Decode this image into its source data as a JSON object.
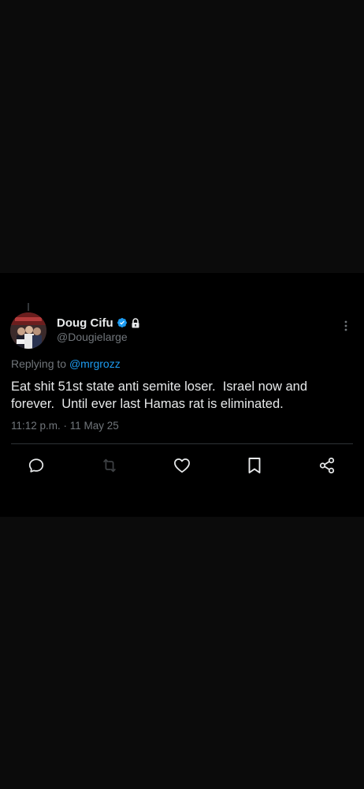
{
  "tweet": {
    "author": {
      "display_name": "Doug Cifu",
      "handle": "@Dougielarge",
      "verified": true,
      "protected": true
    },
    "reply_prefix": "Replying to",
    "reply_to": "@mrgrozz",
    "text": "Eat shit 51st state anti semite loser.  Israel now and forever.  Until ever last Hamas rat is eliminated.",
    "timestamp": "11:12 p.m. · 11 May 25"
  },
  "icons": {
    "verified": "verified-badge-icon",
    "lock": "lock-icon",
    "more": "more-vertical-icon",
    "reply": "reply-icon",
    "retweet": "retweet-icon",
    "like": "heart-icon",
    "bookmark": "bookmark-icon",
    "share": "share-icon"
  },
  "colors": {
    "background": "#000000",
    "page_background": "#0b0b0b",
    "primary_text": "#e7e9ea",
    "secondary_text": "#71767b",
    "accent": "#1d9bf0",
    "retweet_disabled": "#3e4144"
  }
}
